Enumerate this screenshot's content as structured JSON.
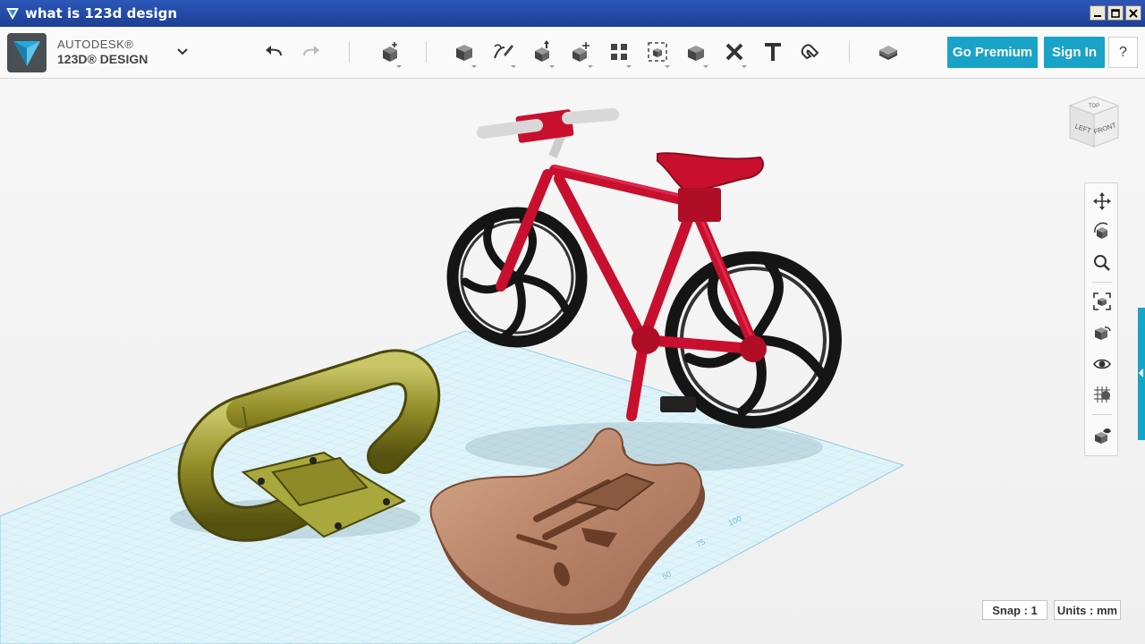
{
  "window": {
    "title": "what is 123d design",
    "minimize": "_",
    "maximize": "□",
    "close": "×"
  },
  "brand": {
    "line1": "AUTODESK®",
    "line2": "123D® DESIGN"
  },
  "toolbar": {
    "undo": "undo-icon",
    "redo": "redo-icon",
    "tools": [
      "primitives",
      "sketch",
      "construct",
      "modify",
      "pattern",
      "grouping",
      "combine",
      "measure",
      "text",
      "snap"
    ],
    "materials": "materials-icon",
    "go_premium": "Go Premium",
    "sign_in": "Sign In",
    "help": "?"
  },
  "viewcube": {
    "left": "LEFT",
    "front": "FRONT",
    "top": "TOP"
  },
  "nav": [
    "pan",
    "orbit",
    "zoom",
    "fit",
    "views",
    "visibility",
    "grid-material",
    "solid-visibility"
  ],
  "status": {
    "snap": "Snap : 1",
    "units": "Units : mm"
  },
  "grid_labels": [
    "25",
    "50",
    "75",
    "100"
  ],
  "colors": {
    "accent": "#1aa3c8",
    "titlebar": "#1d3f95",
    "bike": "#c8102e",
    "grid": "#bfe6f2"
  }
}
